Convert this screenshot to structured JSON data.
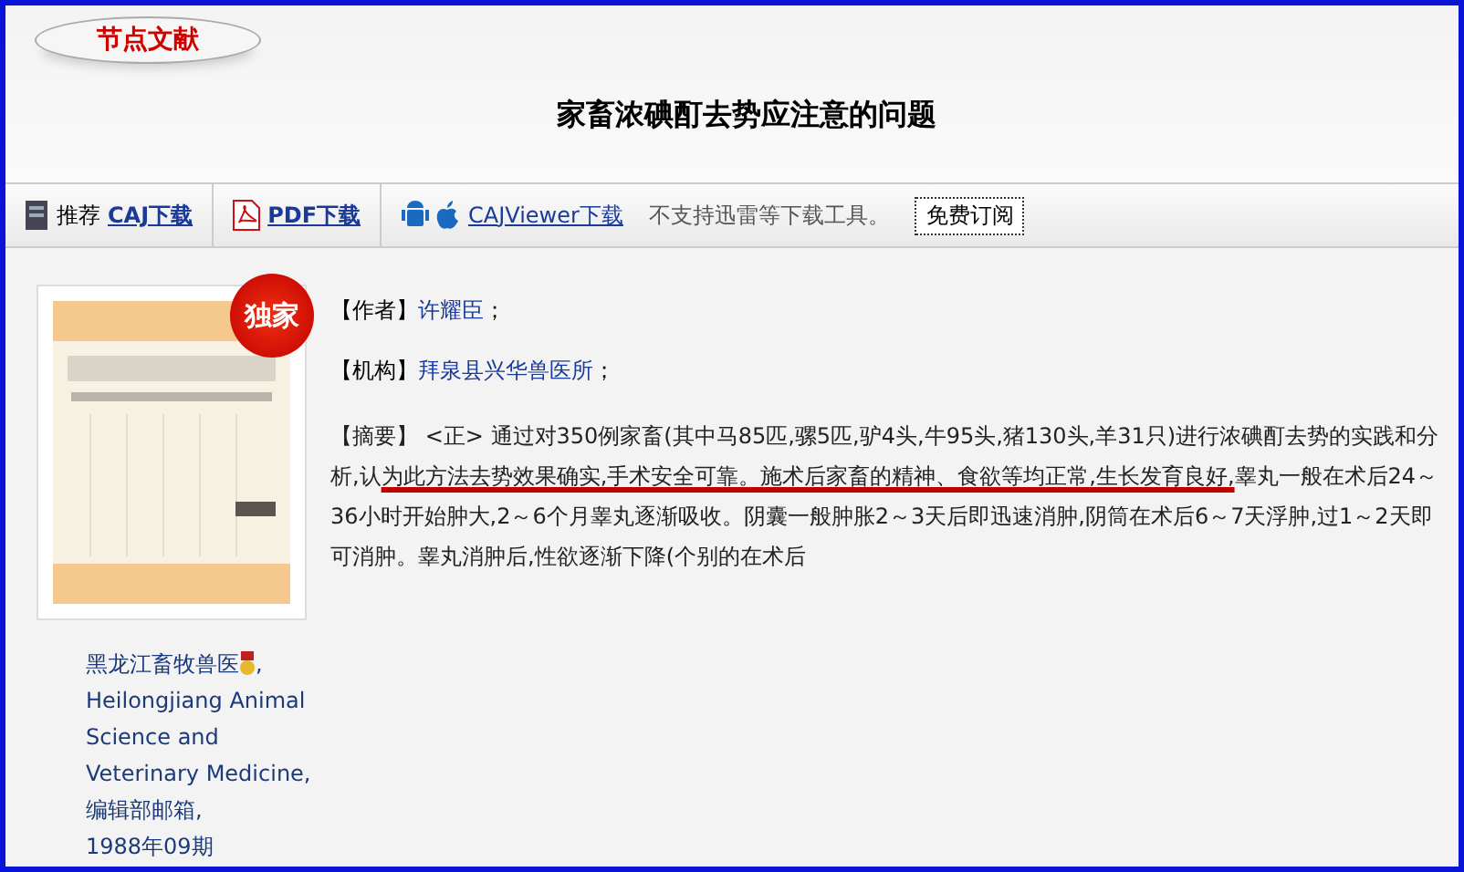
{
  "logo": {
    "text": "节点文献"
  },
  "title": "家畜浓碘酊去势应注意的问题",
  "toolbar": [
    {
      "kind": "caj",
      "prefix": "推荐",
      "link": "CAJ下载"
    },
    {
      "kind": "pdf",
      "link": "PDF下载"
    },
    {
      "kind": "mobile",
      "link": "CAJViewer下载",
      "note": "不支持迅雷等下载工具。",
      "button": "免费订阅"
    }
  ],
  "cover": {
    "kind": "picture",
    "badge": "独家"
  },
  "journal": {
    "name": "黑龙江畜牧兽医",
    "suffix": ",",
    "lines": [
      "Heilongjiang Animal",
      "Science and",
      "Veterinary Medicine,",
      "编辑部邮箱,",
      "1988年09期"
    ]
  },
  "fields": [
    {
      "label": "【作者】",
      "value": "许耀臣",
      "end": "；"
    },
    {
      "label": "【机构】",
      "value": "拜泉县兴华兽医所",
      "end": "；"
    }
  ],
  "abstract": {
    "label": "【摘要】",
    "before": "<正> 通过对350例家畜(其中马85匹,骡5匹,驴4头,牛95头,猪130头,羊31只)进行浓碘酊去势的实践和分析,认",
    "underlined": "为此方法去势效果确实,手术安全可靠。施术后家畜的精神、食欲等均正常,生长发育良好,",
    "after": "睾丸一般在术后24～36小时开始肿大,2～6个月睾丸逐渐吸收。阴囊一般肿胀2～3天后即迅速消肿,阴筒在术后6～7天浮肿,过1～2天即可消肿。睾丸消肿后,性欲逐渐下降(个别的在术后"
  }
}
